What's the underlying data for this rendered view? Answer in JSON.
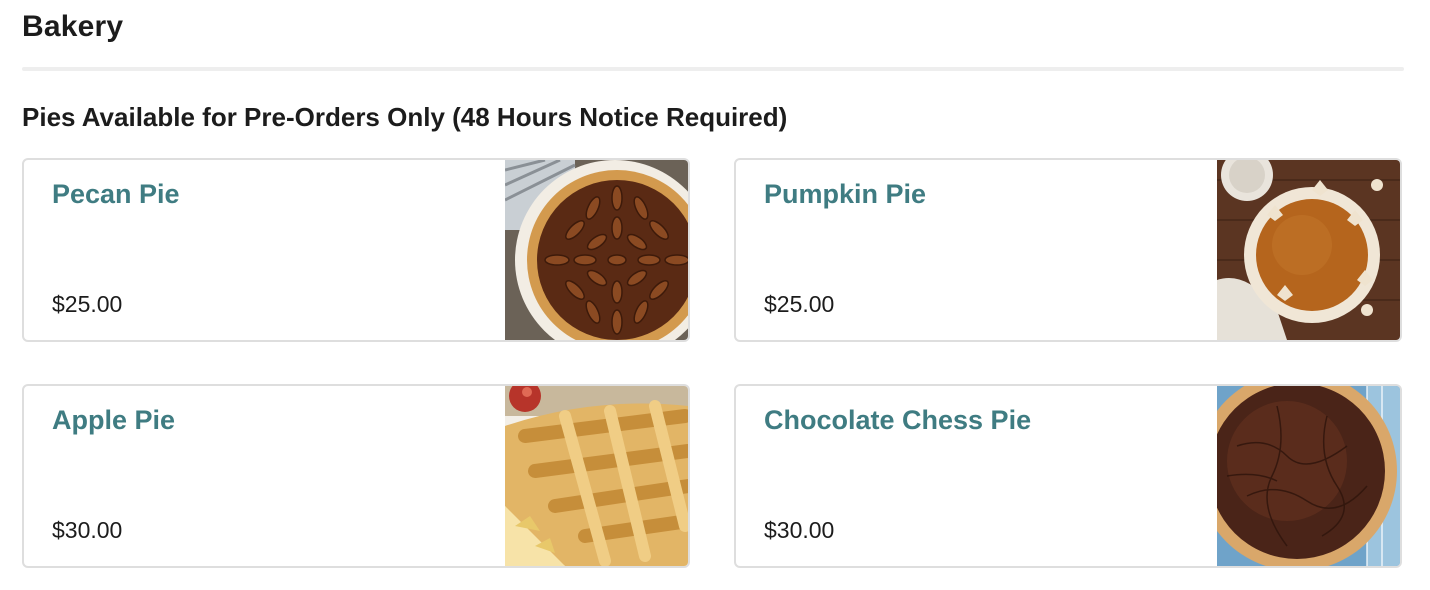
{
  "section": {
    "title": "Bakery",
    "subheading": "Pies Available for Pre-Orders Only (48 Hours Notice Required)"
  },
  "items": [
    {
      "name": "Pecan Pie",
      "price": "$25.00",
      "image": "pecan-pie-photo"
    },
    {
      "name": "Pumpkin Pie",
      "price": "$25.00",
      "image": "pumpkin-pie-photo"
    },
    {
      "name": "Apple Pie",
      "price": "$30.00",
      "image": "apple-pie-photo"
    },
    {
      "name": "Chocolate Chess Pie",
      "price": "$30.00",
      "image": "chocolate-chess-pie-photo"
    }
  ],
  "colors": {
    "item_name": "#3f7c82",
    "card_border": "#dedede",
    "divider": "#eeeeee"
  }
}
